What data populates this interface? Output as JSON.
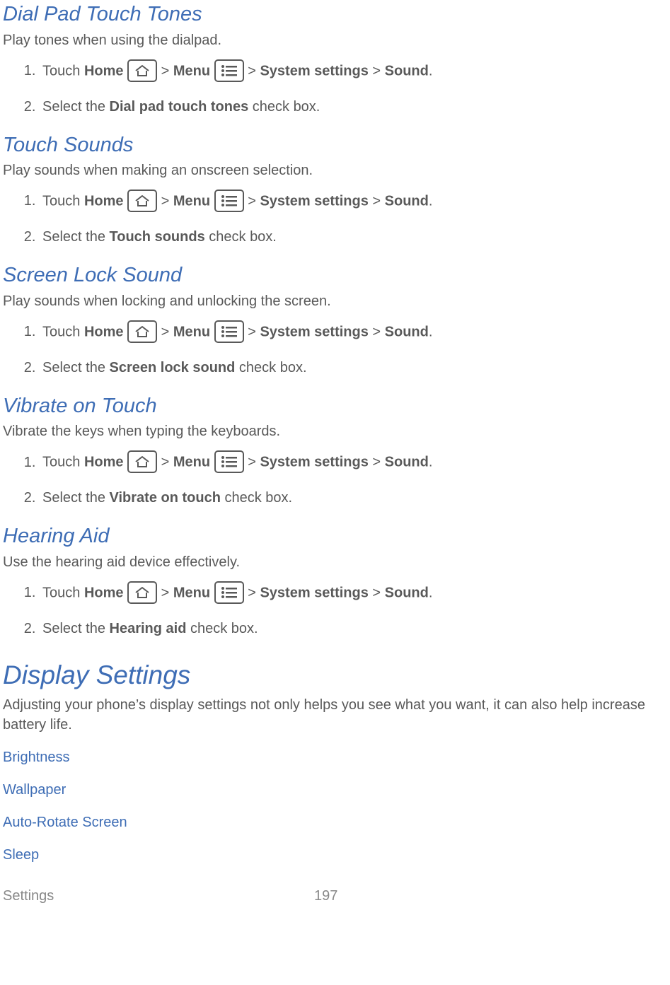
{
  "common": {
    "touch": "Touch ",
    "home": "Home",
    "sep": " > ",
    "menu": "Menu",
    "systemSettings": "System settings",
    "sound": "Sound",
    "period": ".",
    "selectThe": "Select the ",
    "checkBox": " check box."
  },
  "sections": [
    {
      "heading": "Dial Pad Touch Tones",
      "desc": "Play tones when using the dialpad.",
      "option": "Dial pad touch tones"
    },
    {
      "heading": "Touch Sounds",
      "desc": "Play sounds when making an onscreen selection.",
      "option": "Touch sounds"
    },
    {
      "heading": "Screen Lock Sound",
      "desc": "Play sounds when locking and unlocking the screen.",
      "option": "Screen lock sound"
    },
    {
      "heading": "Vibrate on Touch",
      "desc": "Vibrate the keys when typing the keyboards.",
      "option": "Vibrate on touch"
    },
    {
      "heading": "Hearing Aid",
      "desc": "Use the hearing aid device effectively.",
      "option": "Hearing aid"
    }
  ],
  "displaySection": {
    "heading": "Display Settings",
    "desc": "Adjusting your phone’s display settings not only helps you see what you want, it can also help increase battery life.",
    "links": [
      "Brightness",
      "Wallpaper",
      "Auto-Rotate Screen",
      "Sleep"
    ]
  },
  "footer": {
    "title": "Settings",
    "page": "197"
  }
}
